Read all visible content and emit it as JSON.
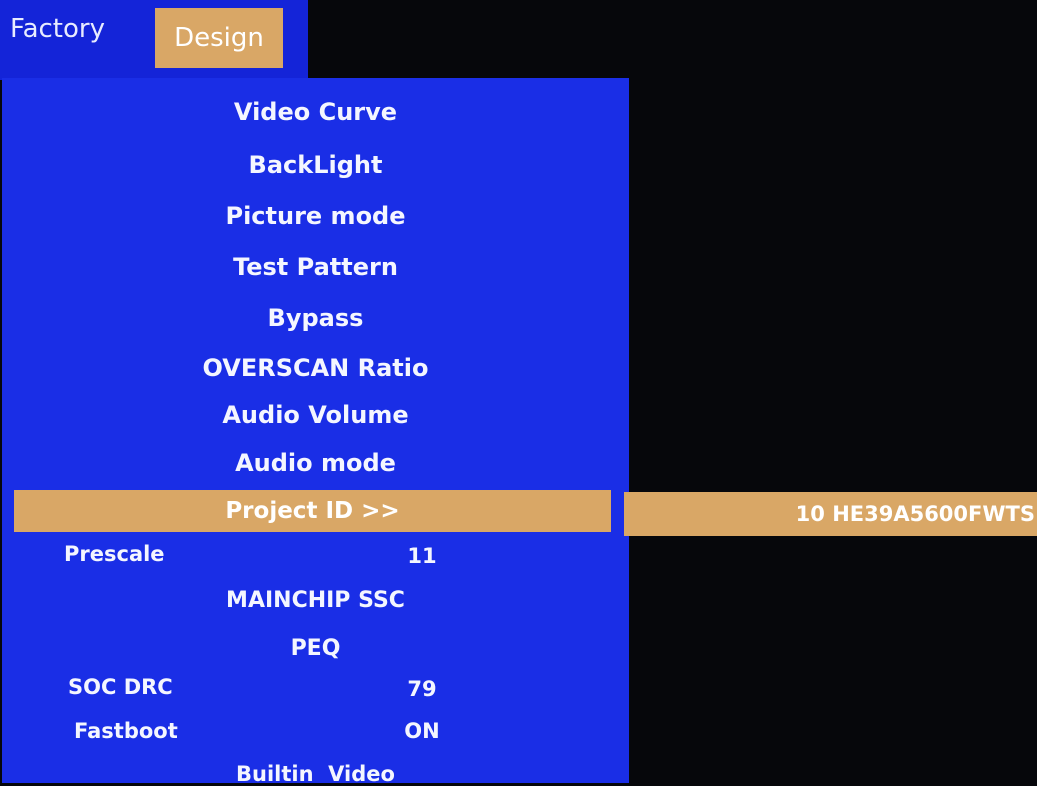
{
  "tabs": {
    "factory": "Factory",
    "design": "Design"
  },
  "menu": {
    "items": [
      "Video Curve",
      "BackLight",
      "Picture mode",
      "Test Pattern",
      "Bypass",
      "OVERSCAN Ratio",
      "Audio Volume",
      "Audio mode"
    ],
    "selected": "Project ID >>",
    "selected_value": "10 HE39A5600FWTS",
    "rows": [
      {
        "label": "Prescale",
        "value": "11"
      },
      {
        "label": "",
        "value": "MAINCHIP SSC"
      },
      {
        "label": "",
        "value": "PEQ"
      },
      {
        "label": "SOC DRC",
        "value": "79"
      },
      {
        "label": "Fastboot",
        "value": "ON"
      },
      {
        "label": "",
        "value": "Builtin  Video"
      }
    ]
  },
  "colors": {
    "panel": "#1a2ee6",
    "highlight": "#d9a766",
    "background": "#06070b"
  }
}
